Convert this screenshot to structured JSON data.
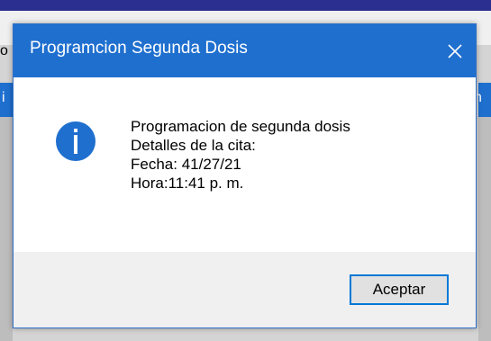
{
  "dialog": {
    "title": "Programcion Segunda Dosis",
    "close_icon": "close-icon",
    "message_icon": "info-icon",
    "message_lines": [
      "Programacion de segunda dosis",
      "Detalles de la cita:",
      "Fecha: 41/27/21",
      "Hora:11:41 p. m."
    ],
    "ok_label": "Aceptar"
  },
  "background": {
    "fragment_left_top": "o",
    "fragment_left_mid": "i",
    "fragment_right_top": "",
    "fragment_right_mid": "n"
  },
  "colors": {
    "titlebar": "#1f6fcf",
    "button_border": "#0078d7",
    "footer": "#f0f0f0"
  }
}
